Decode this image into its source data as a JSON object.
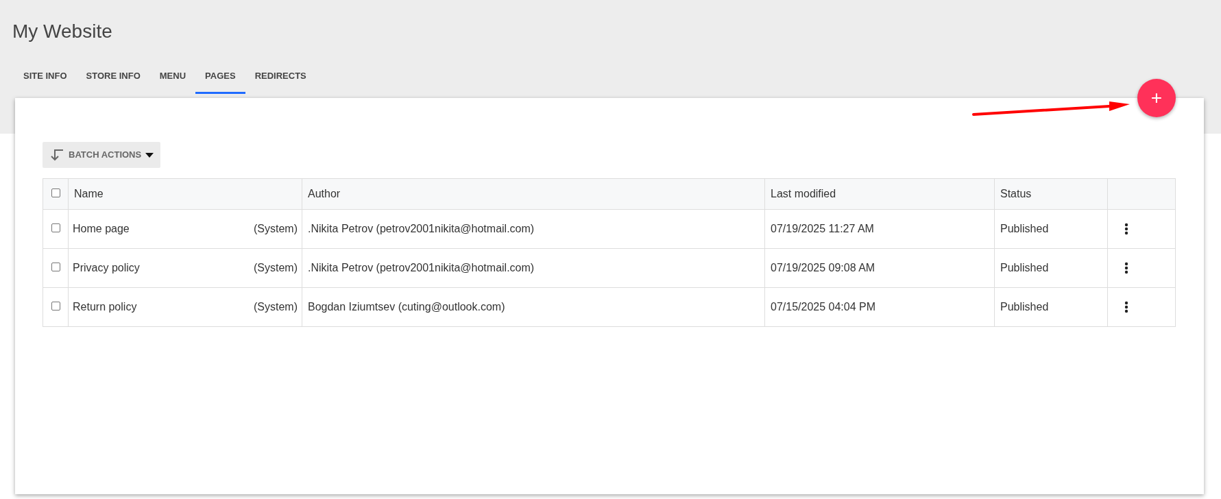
{
  "site_title": "My Website",
  "tabs": [
    {
      "label": "SITE INFO",
      "selected": false
    },
    {
      "label": "STORE INFO",
      "selected": false
    },
    {
      "label": "MENU",
      "selected": false
    },
    {
      "label": "PAGES",
      "selected": true
    },
    {
      "label": "REDIRECTS",
      "selected": false
    }
  ],
  "add_button": {
    "label": "+"
  },
  "batch_actions": {
    "label": "BATCH ACTIONS"
  },
  "table": {
    "select_all": {
      "checked": false
    },
    "columns": [
      "Name",
      "Author",
      "Last modified",
      "Status"
    ],
    "rows": [
      {
        "checked": false,
        "name": "Home page",
        "tag": "(System)",
        "author": ".Nikita Petrov (petrov2001nikita@hotmail.com)",
        "last_modified": "07/19/2025 11:27 AM",
        "status": "Published"
      },
      {
        "checked": false,
        "name": "Privacy policy",
        "tag": "(System)",
        "author": ".Nikita Petrov (petrov2001nikita@hotmail.com)",
        "last_modified": "07/19/2025 09:08 AM",
        "status": "Published"
      },
      {
        "checked": false,
        "name": "Return policy",
        "tag": "(System)",
        "author": "Bogdan Iziumtsev (cuting@outlook.com)",
        "last_modified": "07/15/2025 04:04 PM",
        "status": "Published"
      }
    ]
  }
}
